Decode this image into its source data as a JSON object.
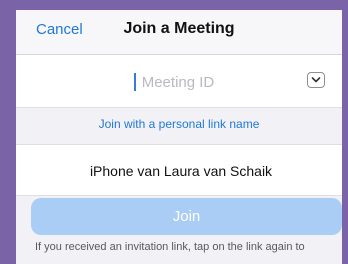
{
  "header": {
    "cancel_label": "Cancel",
    "title": "Join a Meeting"
  },
  "meeting_id": {
    "placeholder": "Meeting ID",
    "value": "",
    "dropdown_icon": "chevron-down-icon"
  },
  "personal_link": {
    "label": "Join with a personal link name"
  },
  "screen_name": {
    "value": "iPhone van Laura van Schaik"
  },
  "join_button": {
    "label": "Join",
    "state": "disabled"
  },
  "info": {
    "text": "If you received an invitation link, tap on the link again to"
  },
  "colors": {
    "accent": "#1f78d9",
    "join_disabled": "#a9cdf4",
    "background_frame": "#7a63a6"
  }
}
